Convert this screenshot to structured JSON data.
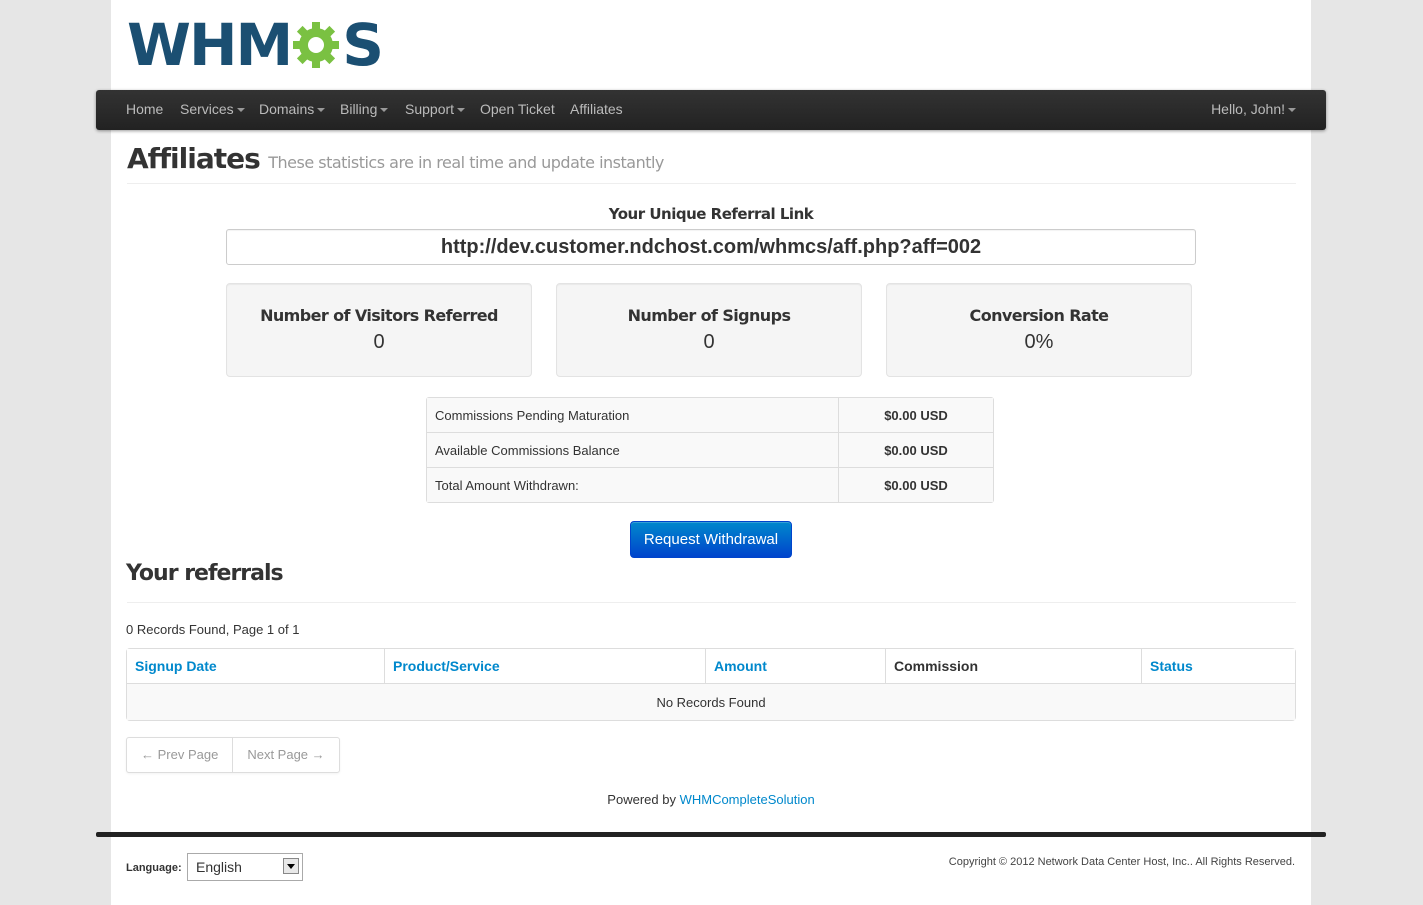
{
  "brand": {
    "logo_text_left": "WHM",
    "logo_text_right": "S",
    "logo_gear_color": "#7ac142",
    "logo_text_color": "#1b4f72"
  },
  "nav": {
    "home": "Home",
    "services": "Services",
    "domains": "Domains",
    "billing": "Billing",
    "support": "Support",
    "open_ticket": "Open Ticket",
    "affiliates": "Affiliates",
    "user_menu": "Hello, John!"
  },
  "page": {
    "title": "Affiliates",
    "subtitle": "These statistics are in real time and update instantly"
  },
  "referral": {
    "label": "Your Unique Referral Link",
    "link": "http://dev.customer.ndchost.com/whmcs/aff.php?aff=002"
  },
  "stats": {
    "visitors": {
      "label": "Number of Visitors Referred",
      "value": "0"
    },
    "signups": {
      "label": "Number of Signups",
      "value": "0"
    },
    "conversion": {
      "label": "Conversion Rate",
      "value": "0%"
    }
  },
  "commissions": [
    {
      "label": "Commissions Pending Maturation",
      "value": "$0.00 USD"
    },
    {
      "label": "Available Commissions Balance",
      "value": "$0.00 USD"
    },
    {
      "label": "Total Amount Withdrawn:",
      "value": "$0.00 USD"
    }
  ],
  "withdraw_button": "Request Withdrawal",
  "referrals": {
    "title": "Your referrals",
    "records_info": "0 Records Found, Page 1 of 1",
    "columns": [
      "Signup Date",
      "Product/Service",
      "Amount",
      "Commission",
      "Status"
    ],
    "empty_message": "No Records Found"
  },
  "pager": {
    "prev": "← Prev Page",
    "next": "Next Page →"
  },
  "footer": {
    "powered_by": "Powered by",
    "powered_link": "WHMCompleteSolution",
    "language_label": "Language:",
    "language_value": "English",
    "copyright": "Copyright © 2012 Network Data Center Host, Inc.. All Rights Reserved."
  },
  "colors": {
    "link": "#0088cc",
    "navbar": "#222222",
    "primary_button": "#0055cc"
  }
}
